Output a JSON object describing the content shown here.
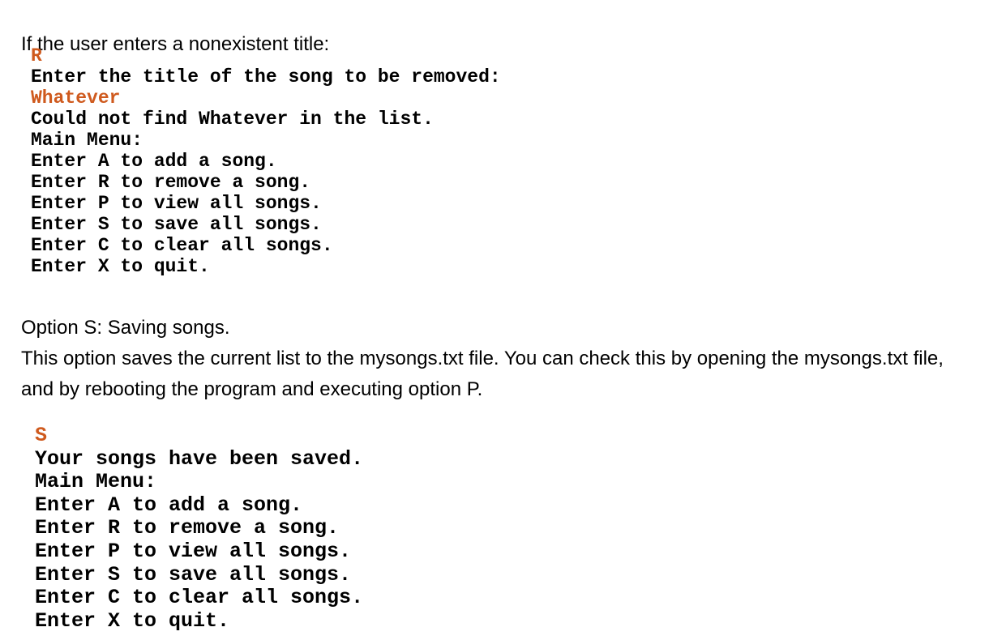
{
  "document": {
    "background_color": "#ffffff",
    "text_color": "#000000",
    "user_input_color": "#cf5a1e"
  },
  "intro": {
    "text": "If the user enters a nonexistent title:"
  },
  "console_remove": {
    "lines": [
      {
        "text": "R",
        "kind": "user-input"
      },
      {
        "text": "Enter the title of the song to be removed:",
        "kind": "output"
      },
      {
        "text": "Whatever",
        "kind": "user-input"
      },
      {
        "text": "Could not find Whatever in the list.",
        "kind": "output"
      },
      {
        "text": "Main Menu:",
        "kind": "output"
      },
      {
        "text": "Enter A to add a song.",
        "kind": "output"
      },
      {
        "text": "Enter R to remove a song.",
        "kind": "output"
      },
      {
        "text": "Enter P to view all songs.",
        "kind": "output"
      },
      {
        "text": "Enter S to save all songs.",
        "kind": "output"
      },
      {
        "text": "Enter C to clear all songs.",
        "kind": "output"
      },
      {
        "text": "Enter X to quit.",
        "kind": "output"
      }
    ]
  },
  "section": {
    "heading": "Option S: Saving songs.",
    "body": "This option saves the current list to the mysongs.txt file. You can check this by opening the mysongs.txt file, and by rebooting the program and executing option P."
  },
  "console_save": {
    "lines": [
      {
        "text": "S",
        "kind": "user-input"
      },
      {
        "text": "Your songs have been saved.",
        "kind": "output"
      },
      {
        "text": "Main Menu:",
        "kind": "output"
      },
      {
        "text": "Enter A to add a song.",
        "kind": "output"
      },
      {
        "text": "Enter R to remove a song.",
        "kind": "output"
      },
      {
        "text": "Enter P to view all songs.",
        "kind": "output"
      },
      {
        "text": "Enter S to save all songs.",
        "kind": "output"
      },
      {
        "text": "Enter C to clear all songs.",
        "kind": "output"
      },
      {
        "text": "Enter X to quit.",
        "kind": "output"
      }
    ]
  }
}
